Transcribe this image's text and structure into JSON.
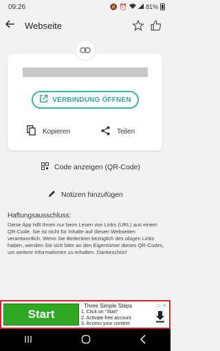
{
  "status_bar": {
    "time": "09:26",
    "battery": "81%"
  },
  "app_bar": {
    "title": "Webseite"
  },
  "card": {
    "open_button": "VERBINDUNG ÖFFNEN",
    "copy_label": "Kopieren",
    "share_label": "Teilen"
  },
  "actions": {
    "qr_label": "Code anzeigen (QR-Code)",
    "notes_label": "Notizen hinzufügen"
  },
  "disclaimer": {
    "title": "Haftungsausschluss:",
    "text": "Diese App hilft Ihnen nur beim Lesen von Links (URL) aus einem QR-Code. Sie ist nicht für Inhalte auf diesen Webseiten verantwortlich. Wenn Sie Bedenken bezüglich des obigen Links haben, wenden Sie sich bitte an den Eigentümer dieses QR-Codes, um weitere Informationen zu erhalten. Dankeschön!"
  },
  "ad": {
    "button": "Start",
    "headline": "Three Simple Steps",
    "step1": "1. Click on \"Start\"",
    "step2": "2. Activate free account",
    "step3": "3. Access your content",
    "badge": "▷ ✕"
  },
  "colors": {
    "accent": "#38b7a6",
    "ad_button": "#2ea823",
    "ad_border": "#d32626"
  },
  "icons": [
    "back-arrow-icon",
    "star-icon",
    "thumbs-up-icon",
    "link-icon",
    "open-external-icon",
    "copy-icon",
    "share-icon",
    "qr-code-icon",
    "pencil-icon",
    "download-icon"
  ]
}
